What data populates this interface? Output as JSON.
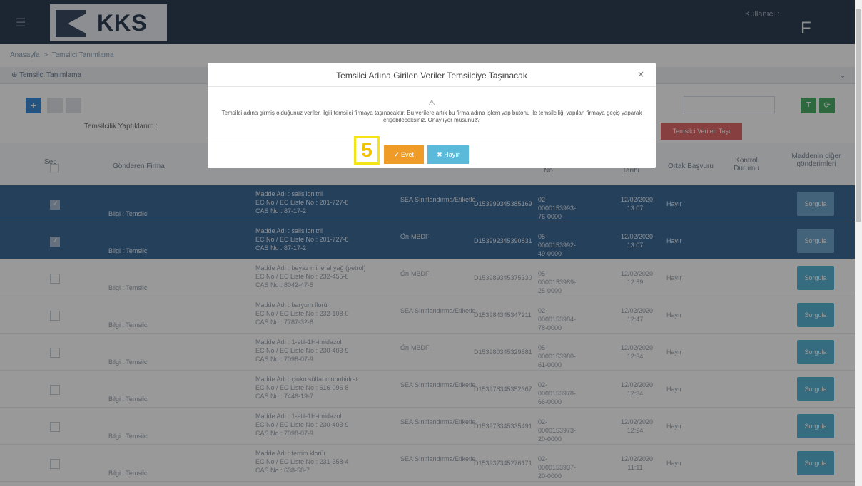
{
  "topbar": {
    "menu_icon": "☰",
    "logo_text": "KKS",
    "user_label": "Kullanıcı :",
    "user_initial": "F"
  },
  "breadcrumb": {
    "home": "Anasayfa",
    "sep": ">",
    "current": "Temsilci Tanımlama"
  },
  "panel": {
    "title": "Temsilci Tanımlama",
    "icon": "⊕",
    "chevron": "⌄"
  },
  "toolbar": {
    "add": "+",
    "filter_icon": "T",
    "refresh_icon": "⟳"
  },
  "filter": {
    "label": "Temsilcilik Yaptıklarım :"
  },
  "transfer_button": "Temsilci Verileri Taşı",
  "table": {
    "headers": {
      "sec": "Seç",
      "firma": "Gönderen Firma",
      "no": "No",
      "tarih": "Tarihi",
      "ortak": "Ortak Başvuru",
      "kontrol": "Kontrol Durumu",
      "diger": "Maddenin diğer gönderimleri"
    },
    "rows": [
      {
        "selected": true,
        "checked": true,
        "firma": "Bilgi : Temsilci",
        "madde": "Madde Adı : salisilonitril",
        "ec": "EC No / EC Liste No : 201-727-8",
        "cas": "CAS No : 87-17-2",
        "tip": "SEA Sınıflandırma/Etiketle",
        "kod": "D153999345385169",
        "no": "02-0000153993-76-0000",
        "tarih": "12/02/2020 13:07",
        "ortak": "Hayır",
        "btn": "Sorgula"
      },
      {
        "selected": true,
        "checked": true,
        "firma": "Bilgi : Temsilci",
        "madde": "Madde Adı : salisilonitril",
        "ec": "EC No / EC Liste No : 201-727-8",
        "cas": "CAS No : 87-17-2",
        "tip": "Ön-MBDF",
        "kod": "D153992345390831",
        "no": "05-0000153992-49-0000",
        "tarih": "12/02/2020 13:07",
        "ortak": "Hayır",
        "btn": "Sorgula"
      },
      {
        "selected": false,
        "checked": false,
        "firma": "Bilgi : Temsilci",
        "madde": "Madde Adı : beyaz mineral yağ (petrol)",
        "ec": "EC No / EC Liste No : 232-455-8",
        "cas": "CAS No : 8042-47-5",
        "tip": "Ön-MBDF",
        "kod": "D153989345375330",
        "no": "05-0000153989-25-0000",
        "tarih": "12/02/2020 12:59",
        "ortak": "Hayır",
        "btn": "Sorgula"
      },
      {
        "selected": false,
        "checked": false,
        "firma": "Bilgi : Temsilci",
        "madde": "Madde Adı : baryum florür",
        "ec": "EC No / EC Liste No : 232-108-0",
        "cas": "CAS No : 7787-32-8",
        "tip": "SEA Sınıflandırma/Etiketle",
        "kod": "D153984345347211",
        "no": "02-0000153984-78-0000",
        "tarih": "12/02/2020 12:47",
        "ortak": "Hayır",
        "btn": "Sorgula"
      },
      {
        "selected": false,
        "checked": false,
        "firma": "Bilgi : Temsilci",
        "madde": "Madde Adı : 1-etil-1H-imidazol",
        "ec": "EC No / EC Liste No : 230-403-9",
        "cas": "CAS No : 7098-07-9",
        "tip": "Ön-MBDF",
        "kod": "D153980345329881",
        "no": "05-0000153980-61-0000",
        "tarih": "12/02/2020 12:34",
        "ortak": "Hayır",
        "btn": "Sorgula"
      },
      {
        "selected": false,
        "checked": false,
        "firma": "Bilgi : Temsilci",
        "madde": "Madde Adı : çinko sülfat monohidrat",
        "ec": "EC No / EC Liste No : 616-096-8",
        "cas": "CAS No : 7446-19-7",
        "tip": "SEA Sınıflandırma/Etiketle",
        "kod": "D153978345352367",
        "no": "02-0000153978-66-0000",
        "tarih": "12/02/2020 12:34",
        "ortak": "Hayır",
        "btn": "Sorgula"
      },
      {
        "selected": false,
        "checked": false,
        "firma": "Bilgi : Temsilci",
        "madde": "Madde Adı : 1-etil-1H-imidazol",
        "ec": "EC No / EC Liste No : 230-403-9",
        "cas": "CAS No : 7098-07-9",
        "tip": "SEA Sınıflandırma/Etiketle",
        "kod": "D153973345335491",
        "no": "02-0000153973-20-0000",
        "tarih": "12/02/2020 12:24",
        "ortak": "Hayır",
        "btn": "Sorgula"
      },
      {
        "selected": false,
        "checked": false,
        "firma": "Bilgi : Temsilci",
        "madde": "Madde Adı : ferrim klorür",
        "ec": "EC No / EC Liste No : 231-358-4",
        "cas": "CAS No : 638-58-7",
        "tip": "SEA Sınıflandırma/Etiketle",
        "kod": "D153937345276171",
        "no": "02-0000153937-20-0000",
        "tarih": "12/02/2020 11:11",
        "ortak": "Hayır",
        "btn": "Sorgula"
      }
    ]
  },
  "modal": {
    "title": "Temsilci Adına Girilen Veriler Temsilciye Taşınacak",
    "close": "×",
    "warning_icon": "⚠",
    "message": "Temsilci adına girmiş olduğunuz veriler, ilgili temsilci firmaya taşınacaktır. Bu verilere artık bu firma adına işlem yap butonu ile temsilciliği yapılan firmaya geçiş yaparak erişebileceksiniz. Onaylıyor musunuz?",
    "yes": "✔ Evet",
    "no": "✖ Hayır"
  },
  "step_marker": "5"
}
